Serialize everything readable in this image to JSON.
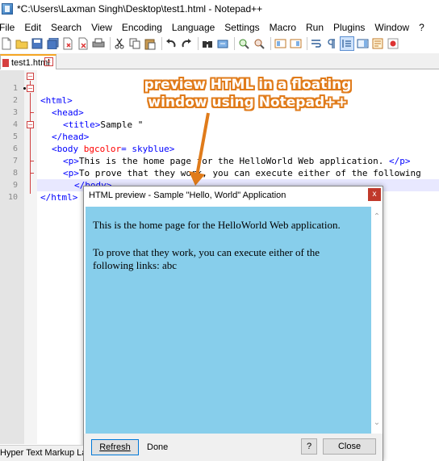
{
  "window": {
    "title": "*C:\\Users\\Laxman Singh\\Desktop\\test1.html - Notepad++"
  },
  "menu": [
    "File",
    "Edit",
    "Search",
    "View",
    "Encoding",
    "Language",
    "Settings",
    "Macro",
    "Run",
    "Plugins",
    "Window",
    "?"
  ],
  "toolbar": {
    "icons": [
      "new-file-icon",
      "open-file-icon",
      "save-icon",
      "save-all-icon",
      "close-icon",
      "close-all-icon",
      "print-icon",
      "cut-icon",
      "copy-icon",
      "paste-icon",
      "undo-icon",
      "redo-icon",
      "find-icon",
      "replace-icon",
      "zoom-in-icon",
      "zoom-out-icon",
      "sync-v-icon",
      "sync-h-icon",
      "word-wrap-icon",
      "show-all-chars-icon",
      "indent-guide-icon",
      "doc-map-icon",
      "function-list-icon",
      "record-macro-icon"
    ]
  },
  "tab": {
    "label": "test1.html",
    "close": "⊠"
  },
  "editor": {
    "line_numbers": [
      "1",
      "2",
      "3",
      "4",
      "5",
      "6",
      "7",
      "8",
      "9",
      "10"
    ],
    "lines": [
      {
        "tag_open": "<html>",
        "text": "",
        "attr": "",
        "rest": ""
      },
      {
        "tag_open": "<head>",
        "text": "",
        "attr": "",
        "rest": ""
      },
      {
        "tag_open": "<title>",
        "text": "Sample \"",
        "attr": "",
        "rest": ""
      },
      {
        "tag_open": "</head>",
        "text": "",
        "attr": "",
        "rest": ""
      },
      {
        "tag_open": "<body ",
        "text": "",
        "attr": "bgcolor",
        "rest": "= skyblue>"
      },
      {
        "tag_open": "<p>",
        "text": "This is the home page for the HelloWorld Web application. ",
        "attr": "",
        "rest": "</p>"
      },
      {
        "tag_open": "<p>",
        "text": "To prove that they work, you can execute either of the following",
        "attr": "",
        "rest": ""
      },
      {
        "tag_open": "</body>",
        "text": "",
        "attr": "",
        "rest": ""
      },
      {
        "tag_open": "</html>",
        "text": "",
        "attr": "",
        "rest": ""
      },
      {
        "tag_open": "",
        "text": "",
        "attr": "",
        "rest": ""
      }
    ]
  },
  "annotation": {
    "line1": "preview HTML in a floating",
    "line2": "window using Notepad++",
    "color": "#e07b1a"
  },
  "preview": {
    "title": "HTML preview - Sample \"Hello, World\" Application",
    "close": "x",
    "paragraph1": "This is the home page for the HelloWorld Web application.",
    "paragraph2": "To prove that they work, you can execute either of the following links: abc",
    "background": "#87ceeb",
    "refresh_label": "Refresh",
    "status": "Done",
    "help_label": "?",
    "close_label": "Close"
  },
  "statusbar": {
    "text": "Hyper Text Markup Language file"
  }
}
